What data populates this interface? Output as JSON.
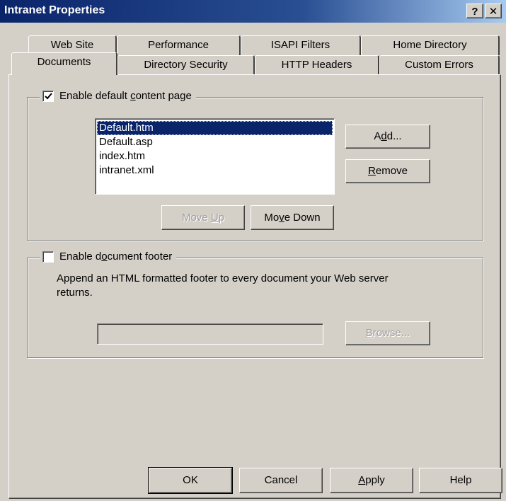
{
  "window": {
    "title": "Intranet Properties",
    "help_glyph": "?",
    "close_glyph": "✕"
  },
  "tabs": {
    "row1": [
      "Web Site",
      "Performance",
      "ISAPI Filters",
      "Home Directory"
    ],
    "row2": [
      "Documents",
      "Directory Security",
      "HTTP Headers",
      "Custom Errors"
    ],
    "active": "Documents"
  },
  "default_content": {
    "checkbox_label_pre": "Enable default ",
    "checkbox_label_ul": "c",
    "checkbox_label_post": "ontent page",
    "checked": true,
    "documents": [
      "Default.htm",
      "Default.asp",
      "index.htm",
      "intranet.xml"
    ],
    "selected_index": 0,
    "add_pre": "A",
    "add_ul": "d",
    "add_post": "d...",
    "remove_ul": "R",
    "remove_post": "emove",
    "move_up_pre": "Move ",
    "move_up_ul": "U",
    "move_up_post": "p",
    "move_down_pre": "Mo",
    "move_down_ul": "v",
    "move_down_post": "e Down"
  },
  "footer": {
    "checkbox_label_pre": "Enable d",
    "checkbox_label_ul": "o",
    "checkbox_label_post": "cument footer",
    "checked": false,
    "description": "Append an HTML formatted footer to every document your Web server returns.",
    "path_value": "",
    "browse_ul": "B",
    "browse_post": "rowse..."
  },
  "buttons": {
    "ok": "OK",
    "cancel": "Cancel",
    "apply_ul": "A",
    "apply_post": "pply",
    "help": "Help"
  }
}
